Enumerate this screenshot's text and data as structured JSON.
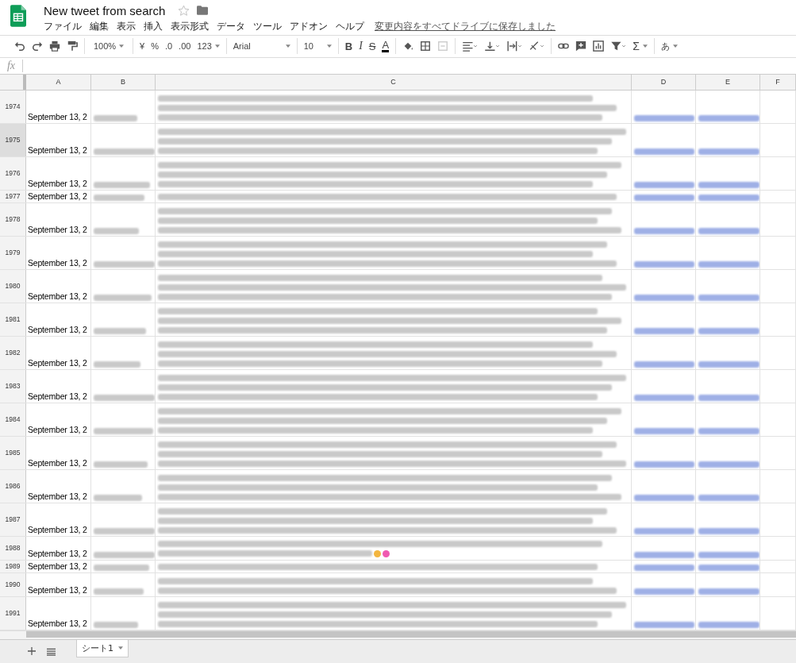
{
  "document": {
    "title": "New tweet from search",
    "starred": false
  },
  "menu": [
    "ファイル",
    "編集",
    "表示",
    "挿入",
    "表示形式",
    "データ",
    "ツール",
    "アドオン",
    "ヘルプ"
  ],
  "save_status": "変更内容をすべてドライブに保存しました",
  "toolbar": {
    "zoom": "100%",
    "currency": "¥",
    "percent": "%",
    "decrease_decimals": ".0",
    "increase_decimals": ".00",
    "number_format": "123",
    "font": "Arial",
    "font_size": "10",
    "bold": "B",
    "italic": "I",
    "strikethrough": "S",
    "text_color": "A",
    "input_tools": "あ",
    "functions": "Σ"
  },
  "formula_bar": {
    "label": "fx"
  },
  "columns": [
    "A",
    "B",
    "C",
    "D",
    "E",
    "F"
  ],
  "rows": [
    {
      "number": "1974",
      "date": "September 13, 2",
      "selected": false,
      "c_lines": [
        {
          "kind": "blurred"
        },
        {
          "kind": "blurred"
        },
        {
          "kind": "blurred"
        }
      ]
    },
    {
      "number": "1975",
      "date": "September 13, 2",
      "selected": true,
      "c_lines": [
        {
          "kind": "blurred"
        },
        {
          "kind": "blurred"
        },
        {
          "kind": "blurred"
        }
      ]
    },
    {
      "number": "1976",
      "date": "September 13, 2",
      "selected": false,
      "c_lines": [
        {
          "kind": "blurred"
        },
        {
          "kind": "blurred"
        },
        {
          "kind": "blurred"
        }
      ]
    },
    {
      "number": "1977",
      "date": "September 13, 2",
      "selected": false,
      "c_lines": [
        {
          "kind": "blurred"
        }
      ]
    },
    {
      "number": "1978",
      "date": "September 13, 2",
      "selected": false,
      "c_lines": [
        {
          "kind": "blurred"
        },
        {
          "kind": "blurred"
        },
        {
          "kind": "blurred"
        }
      ]
    },
    {
      "number": "1979",
      "date": "September 13, 2",
      "selected": false,
      "c_lines": [
        {
          "kind": "blurred"
        },
        {
          "kind": "blurred"
        },
        {
          "kind": "blurred"
        }
      ]
    },
    {
      "number": "1980",
      "date": "September 13, 2",
      "selected": false,
      "c_lines": [
        {
          "kind": "blurred"
        },
        {
          "kind": "blurred"
        },
        {
          "kind": "blurred"
        }
      ]
    },
    {
      "number": "1981",
      "date": "September 13, 2",
      "selected": false,
      "c_lines": [
        {
          "kind": "blurred"
        },
        {
          "kind": "blurred"
        },
        {
          "kind": "blurred"
        }
      ]
    },
    {
      "number": "1982",
      "date": "September 13, 2",
      "selected": false,
      "c_lines": [
        {
          "kind": "blurred"
        },
        {
          "kind": "blurred"
        },
        {
          "kind": "blurred"
        }
      ]
    },
    {
      "number": "1983",
      "date": "September 13, 2",
      "selected": false,
      "c_lines": [
        {
          "kind": "blurred"
        },
        {
          "kind": "blurred"
        },
        {
          "kind": "blurred"
        }
      ]
    },
    {
      "number": "1984",
      "date": "September 13, 2",
      "selected": false,
      "c_lines": [
        {
          "kind": "blurred"
        },
        {
          "kind": "blurred"
        },
        {
          "kind": "blurred"
        }
      ]
    },
    {
      "number": "1985",
      "date": "September 13, 2",
      "selected": false,
      "c_lines": [
        {
          "kind": "blurred"
        },
        {
          "kind": "blurred"
        },
        {
          "kind": "blurred"
        }
      ]
    },
    {
      "number": "1986",
      "date": "September 13, 2",
      "selected": false,
      "c_lines": [
        {
          "kind": "blurred"
        },
        {
          "kind": "blurred"
        },
        {
          "kind": "blurred"
        }
      ]
    },
    {
      "number": "1987",
      "date": "September 13, 2",
      "selected": false,
      "c_lines": [
        {
          "kind": "blurred"
        },
        {
          "kind": "blurred"
        },
        {
          "kind": "blurred"
        }
      ]
    },
    {
      "number": "1988",
      "date": "September 13, 2",
      "selected": false,
      "c_lines": [
        {
          "kind": "blurred"
        },
        {
          "kind": "blurred-emoji"
        }
      ]
    },
    {
      "number": "1989",
      "date": "September 13, 2",
      "selected": false,
      "c_lines": [
        {
          "kind": "blurred"
        }
      ]
    },
    {
      "number": "1990",
      "date": "September 13, 2",
      "selected": false,
      "c_lines": [
        {
          "kind": "blurred"
        },
        {
          "kind": "blurred"
        }
      ]
    },
    {
      "number": "1991",
      "date": "September 13, 2",
      "selected": false,
      "c_lines": [
        {
          "kind": "blurred"
        },
        {
          "kind": "blurred"
        },
        {
          "kind": "blurred"
        }
      ]
    }
  ],
  "sheets": [
    {
      "label": "シート1",
      "selected": true
    }
  ]
}
